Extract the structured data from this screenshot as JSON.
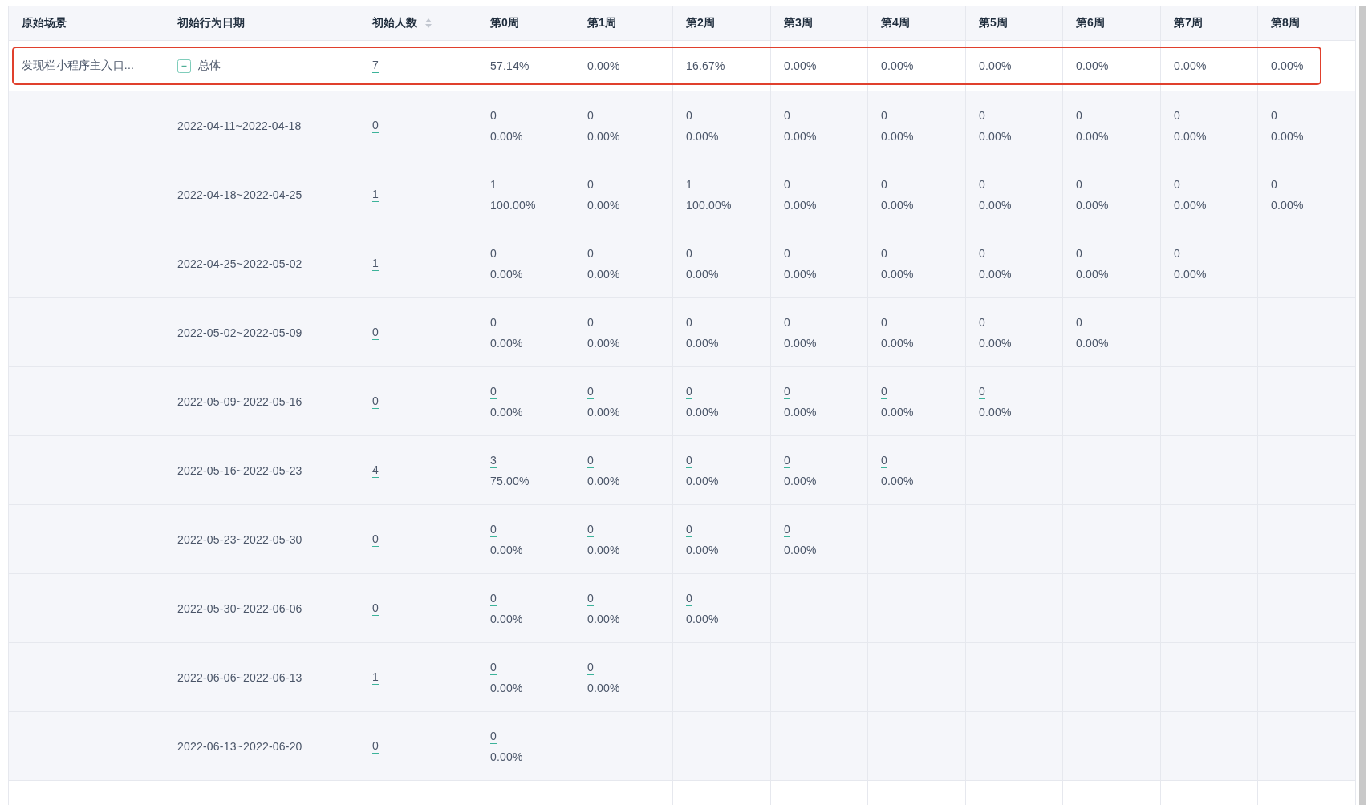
{
  "columns": [
    {
      "label": "原始场景",
      "sortable": false
    },
    {
      "label": "初始行为日期",
      "sortable": false
    },
    {
      "label": "初始人数",
      "sortable": true
    },
    {
      "label": "第0周",
      "sortable": false
    },
    {
      "label": "第1周",
      "sortable": false
    },
    {
      "label": "第2周",
      "sortable": false
    },
    {
      "label": "第3周",
      "sortable": false
    },
    {
      "label": "第4周",
      "sortable": false
    },
    {
      "label": "第5周",
      "sortable": false
    },
    {
      "label": "第6周",
      "sortable": false
    },
    {
      "label": "第7周",
      "sortable": false
    },
    {
      "label": "第8周",
      "sortable": false
    }
  ],
  "summary": {
    "scene": "发现栏小程序主入口...",
    "label": "总体",
    "expanded": true,
    "highlighted": true,
    "total": "7",
    "rates": [
      "57.14%",
      "0.00%",
      "16.67%",
      "0.00%",
      "0.00%",
      "0.00%",
      "0.00%",
      "0.00%",
      "0.00%"
    ]
  },
  "rows": [
    {
      "date": "2022-04-11~2022-04-18",
      "total": "0",
      "cells": [
        {
          "count": "0",
          "rate": "0.00%"
        },
        {
          "count": "0",
          "rate": "0.00%"
        },
        {
          "count": "0",
          "rate": "0.00%"
        },
        {
          "count": "0",
          "rate": "0.00%"
        },
        {
          "count": "0",
          "rate": "0.00%"
        },
        {
          "count": "0",
          "rate": "0.00%"
        },
        {
          "count": "0",
          "rate": "0.00%"
        },
        {
          "count": "0",
          "rate": "0.00%"
        },
        {
          "count": "0",
          "rate": "0.00%"
        }
      ]
    },
    {
      "date": "2022-04-18~2022-04-25",
      "total": "1",
      "cells": [
        {
          "count": "1",
          "rate": "100.00%"
        },
        {
          "count": "0",
          "rate": "0.00%"
        },
        {
          "count": "1",
          "rate": "100.00%"
        },
        {
          "count": "0",
          "rate": "0.00%"
        },
        {
          "count": "0",
          "rate": "0.00%"
        },
        {
          "count": "0",
          "rate": "0.00%"
        },
        {
          "count": "0",
          "rate": "0.00%"
        },
        {
          "count": "0",
          "rate": "0.00%"
        },
        {
          "count": "0",
          "rate": "0.00%"
        }
      ]
    },
    {
      "date": "2022-04-25~2022-05-02",
      "total": "1",
      "cells": [
        {
          "count": "0",
          "rate": "0.00%"
        },
        {
          "count": "0",
          "rate": "0.00%"
        },
        {
          "count": "0",
          "rate": "0.00%"
        },
        {
          "count": "0",
          "rate": "0.00%"
        },
        {
          "count": "0",
          "rate": "0.00%"
        },
        {
          "count": "0",
          "rate": "0.00%"
        },
        {
          "count": "0",
          "rate": "0.00%"
        },
        {
          "count": "0",
          "rate": "0.00%"
        }
      ]
    },
    {
      "date": "2022-05-02~2022-05-09",
      "total": "0",
      "cells": [
        {
          "count": "0",
          "rate": "0.00%"
        },
        {
          "count": "0",
          "rate": "0.00%"
        },
        {
          "count": "0",
          "rate": "0.00%"
        },
        {
          "count": "0",
          "rate": "0.00%"
        },
        {
          "count": "0",
          "rate": "0.00%"
        },
        {
          "count": "0",
          "rate": "0.00%"
        },
        {
          "count": "0",
          "rate": "0.00%"
        }
      ]
    },
    {
      "date": "2022-05-09~2022-05-16",
      "total": "0",
      "cells": [
        {
          "count": "0",
          "rate": "0.00%"
        },
        {
          "count": "0",
          "rate": "0.00%"
        },
        {
          "count": "0",
          "rate": "0.00%"
        },
        {
          "count": "0",
          "rate": "0.00%"
        },
        {
          "count": "0",
          "rate": "0.00%"
        },
        {
          "count": "0",
          "rate": "0.00%"
        }
      ]
    },
    {
      "date": "2022-05-16~2022-05-23",
      "total": "4",
      "cells": [
        {
          "count": "3",
          "rate": "75.00%"
        },
        {
          "count": "0",
          "rate": "0.00%"
        },
        {
          "count": "0",
          "rate": "0.00%"
        },
        {
          "count": "0",
          "rate": "0.00%"
        },
        {
          "count": "0",
          "rate": "0.00%"
        }
      ]
    },
    {
      "date": "2022-05-23~2022-05-30",
      "total": "0",
      "cells": [
        {
          "count": "0",
          "rate": "0.00%"
        },
        {
          "count": "0",
          "rate": "0.00%"
        },
        {
          "count": "0",
          "rate": "0.00%"
        },
        {
          "count": "0",
          "rate": "0.00%"
        }
      ]
    },
    {
      "date": "2022-05-30~2022-06-06",
      "total": "0",
      "cells": [
        {
          "count": "0",
          "rate": "0.00%"
        },
        {
          "count": "0",
          "rate": "0.00%"
        },
        {
          "count": "0",
          "rate": "0.00%"
        }
      ]
    },
    {
      "date": "2022-06-06~2022-06-13",
      "total": "1",
      "cells": [
        {
          "count": "0",
          "rate": "0.00%"
        },
        {
          "count": "0",
          "rate": "0.00%"
        }
      ]
    },
    {
      "date": "2022-06-13~2022-06-20",
      "total": "0",
      "cells": [
        {
          "count": "0",
          "rate": "0.00%"
        }
      ]
    }
  ]
}
